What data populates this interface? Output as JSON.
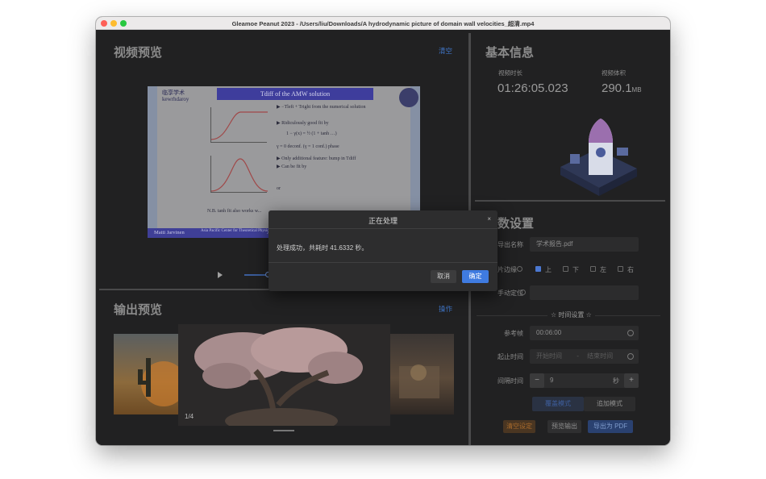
{
  "window": {
    "title": "Gleamoe Peanut 2023 - /Users/liu/Downloads/A hydrodynamic picture of domain wall velocities_超清.mp4"
  },
  "video_preview": {
    "title": "视频预览",
    "clear_label": "清空",
    "slide": {
      "heading": "Tdiff of the AMW solution",
      "logo": "临享学术 kewrhdaroy",
      "lines": [
        "▶ −Tleft + Tright from the numerical solution",
        "▶ Ridiculously good fit by",
        "1 − γ(x) = ½ (1 + tanh …)",
        "γ = 0 deconf. (γ = 1 conf.) phase",
        "▶ Only additional feature: bump in Tdiff",
        "▶ Can be fit by",
        "or",
        "N.B. tanh fit also works w..."
      ],
      "footer_name": "Matti Jarvinen",
      "footer_affil": "Asia Pacific Center for Theoretical Physics",
      "footer_extra": "A h"
    }
  },
  "output_preview": {
    "title": "输出预览",
    "action_label": "操作",
    "page_count": "1/4"
  },
  "basic_info": {
    "title": "基本信息",
    "duration_label": "视频时长",
    "duration_value": "01:26:05.023",
    "size_label": "视频体积",
    "size_value": "290.1",
    "size_unit": "MB"
  },
  "params": {
    "title": "数设置",
    "export_name_label": "导出名称",
    "export_name_value": "学术报告.pdf",
    "edge_label": "片边缘",
    "edge_options": [
      {
        "label": "上",
        "checked": true
      },
      {
        "label": "下",
        "checked": false
      },
      {
        "label": "左",
        "checked": false
      },
      {
        "label": "右",
        "checked": false
      }
    ],
    "manual_label": "手动定位",
    "time_section_label": "☆ 时间设置 ☆",
    "ref_frame_label": "参考帧",
    "ref_frame_value": "00:06:00",
    "range_label": "起止时间",
    "range_start_placeholder": "开始时间",
    "range_sep": "-",
    "range_end_placeholder": "结束时间",
    "interval_label": "间隔时间",
    "interval_minus": "−",
    "interval_value": "9",
    "interval_unit": "秒",
    "interval_plus": "+",
    "mode_override": "覆盖模式",
    "mode_append": "追加模式",
    "btn_clear": "清空设定",
    "btn_preview": "预览输出",
    "btn_export": "导出为 PDF"
  },
  "dialog": {
    "title": "正在处理",
    "close": "×",
    "message": "处理成功，共耗时 41.6332 秒。",
    "cancel": "取消",
    "confirm": "确定"
  },
  "colors": {
    "accent": "#3f7be0",
    "window_bg": "#212122",
    "clear_button": "#c27d2e",
    "export_button": "#2f5fb0"
  }
}
